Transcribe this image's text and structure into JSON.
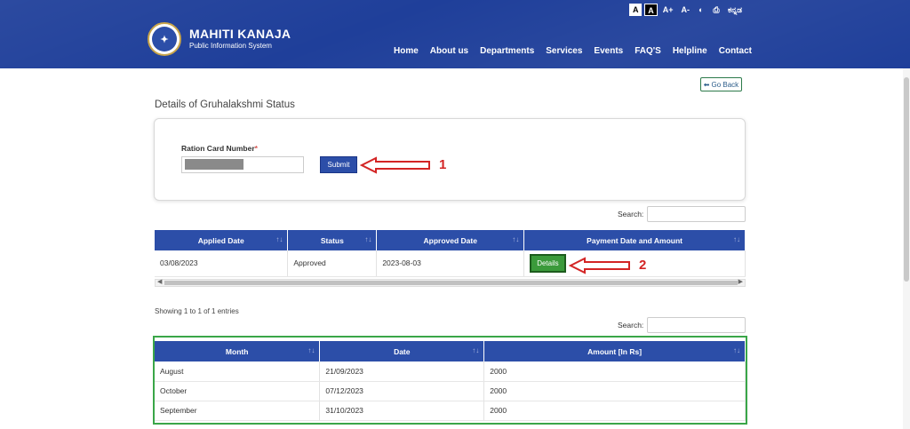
{
  "accessibility": [
    "A",
    "A",
    "A+",
    "A-",
    "◐",
    "⎙",
    "ಕನ್ನಡ"
  ],
  "brand": {
    "title": "MAHITI KANAJA",
    "subtitle": "Public Information System",
    "logo_mark": "✦"
  },
  "nav": [
    "Home",
    "About us",
    "Departments",
    "Services",
    "Events",
    "FAQ'S",
    "Helpline",
    "Contact"
  ],
  "go_back": {
    "icon": "arrow-left-icon",
    "label": "Go Back"
  },
  "page_title": "Details of Gruhalakshmi Status",
  "form": {
    "label": "Ration Card Number",
    "required": "*",
    "submit": "Submit",
    "annotation": "1"
  },
  "search_label": "Search:",
  "status_table": {
    "headers": [
      "Applied Date",
      "Status",
      "Approved Date",
      "Payment Date and Amount"
    ],
    "rows": [
      {
        "applied": "03/08/2023",
        "status": "Approved",
        "approved": "2023-08-03",
        "action": "Details"
      }
    ],
    "annotation": "2"
  },
  "showing": "Showing 1 to 1 of 1 entries",
  "payment_table": {
    "headers": [
      "Month",
      "Date",
      "Amount [In Rs]"
    ],
    "rows": [
      {
        "month": "August",
        "date": "21/09/2023",
        "amount": "2000"
      },
      {
        "month": "October",
        "date": "07/12/2023",
        "amount": "2000"
      },
      {
        "month": "September",
        "date": "31/10/2023",
        "amount": "2000"
      }
    ]
  },
  "sort_icon": "↑↓",
  "colors": {
    "header_bg": "#1f3f9a",
    "table_header": "#2c4ea8",
    "details_btn": "#3b9a3b",
    "annotation": "#d32424",
    "frame": "#3aa648"
  }
}
